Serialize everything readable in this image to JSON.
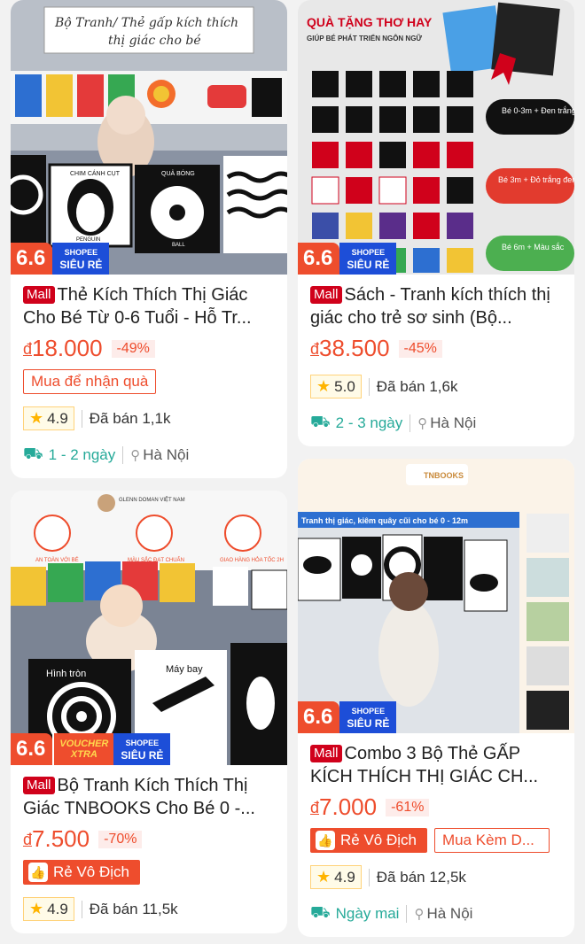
{
  "products": [
    {
      "image_caption_line1": "Bộ Tranh/ Thẻ gấp kích thích",
      "image_caption_line2": "thị giác cho bé",
      "image_labels": [
        "CHIM CÁNH CỤT",
        "PENGUIN",
        "QUẢ BÓNG",
        "BALL"
      ],
      "badge_sale": "6.6",
      "badge_shop_top": "SHOPEE",
      "badge_shop_bottom": "SIÊU RẺ",
      "mall": "Mall",
      "title": "Thẻ Kích Thích Thị Giác Cho Bé Từ 0-6 Tuổi - Hỗ Tr...",
      "currency": "đ",
      "price": "18.000",
      "discount": "-49%",
      "promo": "Mua để nhận quà",
      "rating": "4.9",
      "sold": "Đã bán 1,1k",
      "ship_time": "1 - 2 ngày",
      "location": "Hà Nội"
    },
    {
      "image_title": "QUÀ TẶNG THƠ HAY",
      "image_subtitle": "GIÚP BÉ PHÁT TRIỂN NGÔN NGỮ",
      "image_tags": [
        "Bé 0-3m + Đen trắng",
        "Bé 3m + Đỏ trắng đen",
        "Bé 6m + Màu sắc"
      ],
      "badge_sale": "6.6",
      "badge_shop_top": "SHOPEE",
      "badge_shop_bottom": "SIÊU RẺ",
      "mall": "Mall",
      "title": "Sách - Tranh kích thích thị giác cho trẻ sơ sinh (Bộ...",
      "currency": "đ",
      "price": "38.500",
      "discount": "-45%",
      "rating": "5.0",
      "sold": "Đã bán 1,6k",
      "ship_time": "2 - 3 ngày",
      "location": "Hà Nội"
    },
    {
      "image_icons": [
        "AN TOÀN VỚI BÉ",
        "MÀU SẮC ĐẠT CHUẨN",
        "GIAO HÀNG HỎA TỐC 2H"
      ],
      "image_brand": "GLENN DOMAN VIỆT NAM",
      "image_labels": [
        "Hình tròn",
        "Máy bay"
      ],
      "badge_sale": "6.6",
      "badge_voucher_top": "VOUCHER",
      "badge_voucher_bottom": "XTRA",
      "badge_shop_top": "SHOPEE",
      "badge_shop_bottom": "SIÊU RẺ",
      "mall": "Mall",
      "title": "Bộ Tranh Kích Thích Thị Giác TNBOOKS Cho Bé 0 -...",
      "currency": "đ",
      "price": "7.500",
      "discount": "-70%",
      "promo": "Rẻ Vô Địch",
      "rating": "4.9",
      "sold": "Đã bán 11,5k"
    },
    {
      "image_brand": "TNBOOKS",
      "image_banner": "Tranh thị giác, kiêm quây cũi cho bé 0 - 12m",
      "badge_sale": "6.6",
      "badge_shop_top": "SHOPEE",
      "badge_shop_bottom": "SIÊU RẺ",
      "mall": "Mall",
      "title": "Combo 3 Bộ Thẻ GẤP KÍCH THÍCH THỊ GIÁC CH...",
      "currency": "đ",
      "price": "7.000",
      "discount": "-61%",
      "promo": "Rẻ Vô Địch",
      "promo2": "Mua Kèm D...",
      "rating": "4.9",
      "sold": "Đã bán 12,5k",
      "ship_time": "Ngày mai",
      "location": "Hà Nội"
    }
  ],
  "colors": {
    "accent": "#ee4d2d",
    "mall": "#d0011b",
    "shipping": "#26aa99",
    "shop_badge": "#1d4ed8"
  },
  "icons": [
    "star-icon",
    "truck-icon",
    "location-pin-icon",
    "thumbs-up-icon"
  ]
}
